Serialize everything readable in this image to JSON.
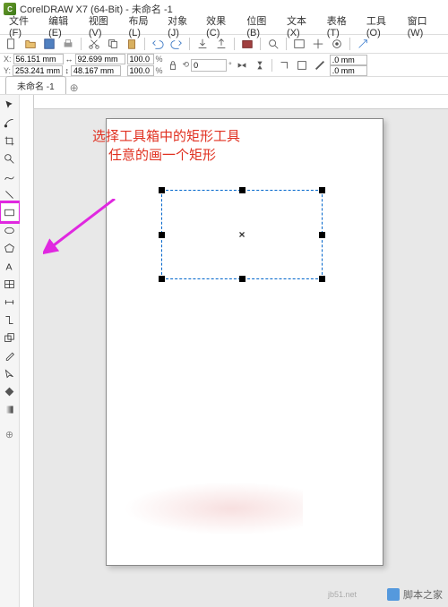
{
  "title": "CorelDRAW X7 (64-Bit) - 未命名 -1",
  "menu": [
    "文件(F)",
    "编辑(E)",
    "视图(V)",
    "布局(L)",
    "对象(J)",
    "效果(C)",
    "位图(B)",
    "文本(X)",
    "表格(T)",
    "工具(O)",
    "窗口(W)"
  ],
  "document_tab": "未命名 -1",
  "prop": {
    "x_label": "X:",
    "y_label": "Y:",
    "x": "56.151 mm",
    "y": "253.241 mm",
    "w": "92.699 mm",
    "h": "48.167 mm",
    "sx": "100.0",
    "sy": "100.0",
    "pct": "%",
    "rot": "0",
    "deg": "°",
    "outline1": ".0 mm",
    "outline2": ".0 mm"
  },
  "annotation": {
    "line1": "选择工具箱中的矩形工具",
    "line2": "任意的画一个矩形"
  },
  "watermark": "脚本之家",
  "watermark_url": "jb51.net",
  "tools": [
    "pick",
    "shape",
    "crop",
    "zoom",
    "freehand",
    "smart",
    "rect",
    "ellipse",
    "polygon",
    "text",
    "table",
    "dim",
    "connect",
    "fx",
    "eyedrop",
    "outline",
    "fill",
    "ifill",
    "plus"
  ]
}
